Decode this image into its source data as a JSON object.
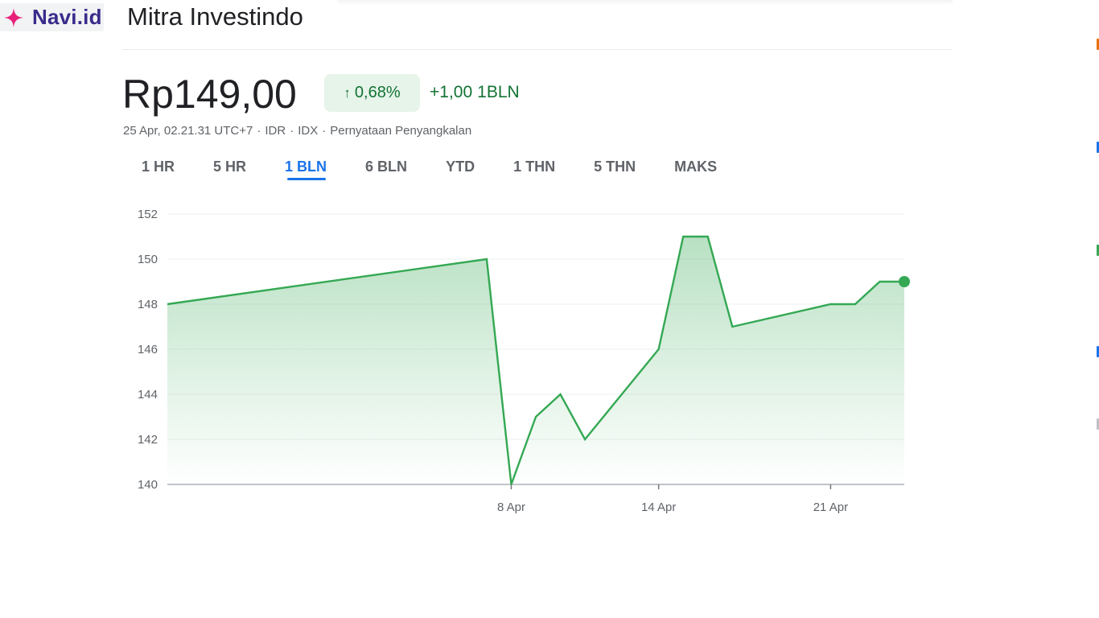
{
  "brand": {
    "name": "Navi.id",
    "icon": "sparkle-icon",
    "color": "#e8207a"
  },
  "header": {
    "company_name": "Mitra Investindo"
  },
  "quote": {
    "price": "Rp149,00",
    "change_percent": "0,68%",
    "change_arrow": "↑",
    "change_abs": "+1,00",
    "change_period": "1BLN",
    "positive_color": "#137333",
    "meta": {
      "timestamp": "25 Apr, 02.21.31 UTC+7",
      "currency": "IDR",
      "exchange": "IDX",
      "disclaimer": "Pernyataan Penyangkalan",
      "separator": "·"
    }
  },
  "tabs": [
    {
      "label": "1 HR",
      "active": false
    },
    {
      "label": "5 HR",
      "active": false
    },
    {
      "label": "1 BLN",
      "active": true
    },
    {
      "label": "6 BLN",
      "active": false
    },
    {
      "label": "YTD",
      "active": false
    },
    {
      "label": "1 THN",
      "active": false
    },
    {
      "label": "5 THN",
      "active": false
    },
    {
      "label": "MAKS",
      "active": false
    }
  ],
  "chart_data": {
    "type": "area",
    "title": "",
    "xlabel": "",
    "ylabel": "",
    "ylim": [
      140,
      152
    ],
    "yticks": [
      140,
      142,
      144,
      146,
      148,
      150,
      152
    ],
    "xticks": [
      {
        "date": "2025-04-08",
        "label": "8 Apr"
      },
      {
        "date": "2025-04-14",
        "label": "14 Apr"
      },
      {
        "date": "2025-04-21",
        "label": "21 Apr"
      }
    ],
    "grid": true,
    "line_color": "#34a853",
    "points": [
      {
        "date": "2025-03-25",
        "value": 148
      },
      {
        "date": "2025-04-07",
        "value": 150
      },
      {
        "date": "2025-04-08",
        "value": 140
      },
      {
        "date": "2025-04-09",
        "value": 143
      },
      {
        "date": "2025-04-10",
        "value": 144
      },
      {
        "date": "2025-04-11",
        "value": 142
      },
      {
        "date": "2025-04-14",
        "value": 146
      },
      {
        "date": "2025-04-15",
        "value": 151
      },
      {
        "date": "2025-04-16",
        "value": 151
      },
      {
        "date": "2025-04-17",
        "value": 147
      },
      {
        "date": "2025-04-21",
        "value": 148
      },
      {
        "date": "2025-04-22",
        "value": 148
      },
      {
        "date": "2025-04-23",
        "value": 149
      },
      {
        "date": "2025-04-24",
        "value": 149
      }
    ]
  },
  "right_edge_marks": [
    {
      "color": "#e8710a"
    },
    {
      "color": "#1a73e8"
    },
    {
      "color": "#34a853"
    },
    {
      "color": "#1a73e8"
    },
    {
      "color": "#bdc1c6"
    }
  ]
}
